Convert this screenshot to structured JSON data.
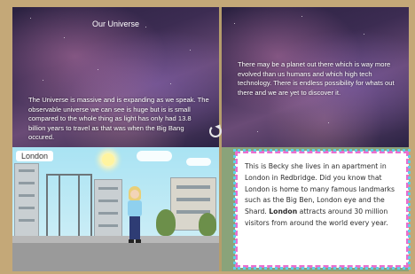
{
  "left_page": {
    "title": "Our Universe",
    "text": "The Universe is massive and is expanding as we speak. The observable universe we can see is huge but is is small compared to the whole thing as light has only had 13.8 billion years to travel as that was when the Big Bang occured."
  },
  "right_page": {
    "text": "There may be a planet out there which is way more evolved than us humans and which high tech technology. There is endless possibility for whats out there and we are yet to discover it."
  },
  "city_scene": {
    "label": "London"
  },
  "note_card": {
    "intro": "This is Becky she lives in an apartment in London in Redbridge. Did you know that London is home to many famous landmarks such as the Big Ben, London eye and the Shard.",
    "bold_word": "London",
    "outro": " attracts around 30 million visitors from around the world every year."
  },
  "icons": {
    "page_turn": "page-turn-icon"
  }
}
